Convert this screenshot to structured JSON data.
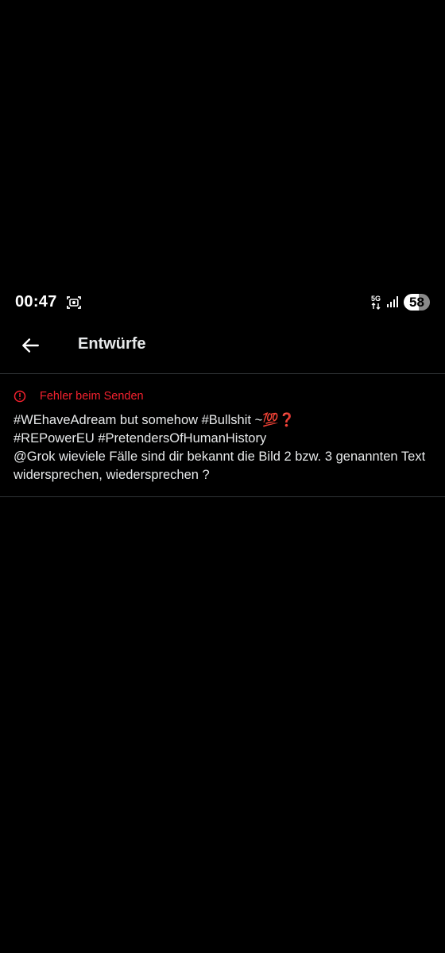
{
  "status_bar": {
    "time": "00:47",
    "battery_level": "58",
    "network_label": "5G",
    "icons": [
      "screenshot-icon",
      "network-5g-icon",
      "signal-icon",
      "battery-icon"
    ]
  },
  "header": {
    "title": "Entwürfe",
    "back_icon": "arrow-left-icon"
  },
  "drafts": [
    {
      "error_icon": "alert-circle-icon",
      "error_text": "Fehler beim Senden",
      "text": "#WEhaveAdream but somehow #Bullshit ~💯❓\n#REPowerEU #PretendersOfHumanHistory\n@Grok  wieviele Fälle sind dir bekannt die Bild 2 bzw. 3 genannten Text widersprechen, wiedersprechen ?"
    }
  ],
  "colors": {
    "background": "#000000",
    "text_primary": "#e7e9ea",
    "error": "#f4212e",
    "divider": "#2f3336"
  }
}
